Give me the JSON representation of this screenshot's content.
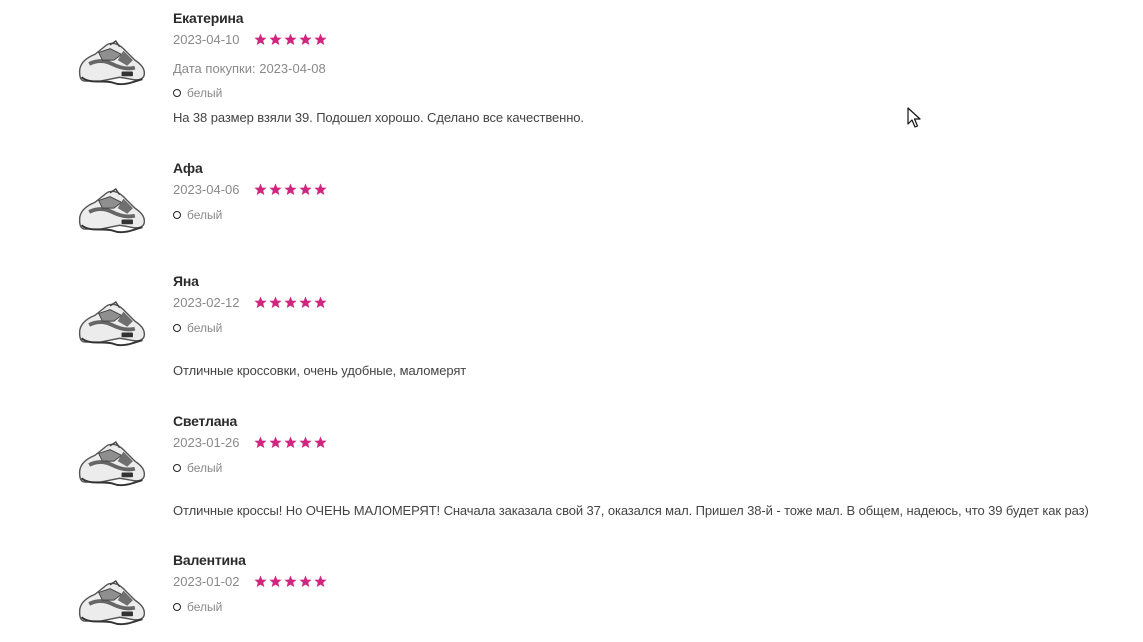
{
  "reviews": [
    {
      "name": "Екатерина",
      "date": "2023-04-10",
      "rating": 5,
      "purchase": "Дата покупки: 2023-04-08",
      "color": "белый",
      "text": "На 38 размер взяли 39. Подошел хорошо. Сделано все качественно."
    },
    {
      "name": "Афа",
      "date": "2023-04-06",
      "rating": 5,
      "color": "белый",
      "text": ""
    },
    {
      "name": "Яна",
      "date": "2023-02-12",
      "rating": 5,
      "color": "белый",
      "text": "Отличные кроссовки, очень удобные, маломерят"
    },
    {
      "name": "Светлана",
      "date": "2023-01-26",
      "rating": 5,
      "color": "белый",
      "text": "Отличные кроссы! Но ОЧЕНЬ МАЛОМЕРЯТ! Сначала заказала свой 37, оказался мал. Пришел 38-й - тоже мал. В общем, надеюсь, что 39 будет как раз)"
    },
    {
      "name": "Валентина",
      "date": "2023-01-02",
      "rating": 5,
      "color": "белый",
      "text": ""
    }
  ],
  "colors": {
    "star": "#d1267f",
    "name": "#2b2b2b",
    "muted": "#8a8a8a"
  },
  "icons": {
    "star": "star-icon",
    "thumbnail": "sneaker-thumbnail",
    "cursor": "mouse-cursor-icon",
    "color_swatch": "color-dot-icon"
  }
}
